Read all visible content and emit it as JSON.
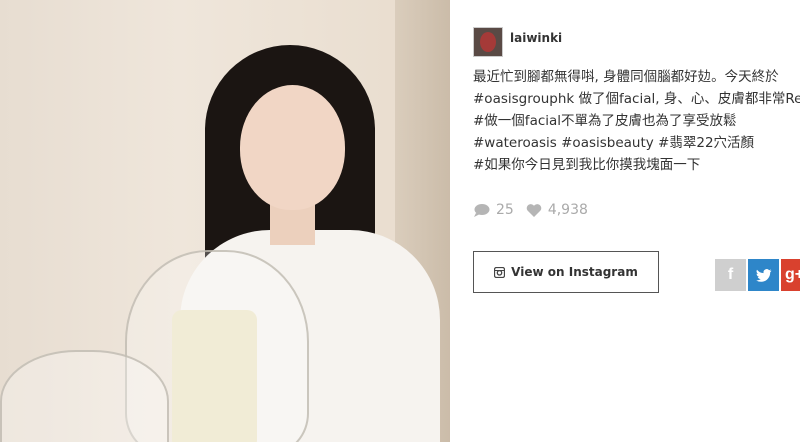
{
  "post": {
    "username": "laiwinki",
    "caption_lines": [
      "最近忙到腳都無得唞, 身體同個腦都好攰。今天終於",
      "#oasisgrouphk 做了個facial, 身、心、皮膚都非常Re",
      "#做一個facial不單為了皮膚也為了享受放鬆",
      "#wateroasis #oasisbeauty #翡翠22穴活顏",
      "#如果你今日見到我比你摸我塊面一下"
    ],
    "comments": "25",
    "likes": "4,938"
  },
  "actions": {
    "view_on_instagram": "View on Instagram",
    "share_buttons": [
      {
        "name": "facebook",
        "glyph": "f",
        "color": "#c7c7c7"
      },
      {
        "name": "twitter",
        "glyph": "t",
        "color": "#2e86c9"
      },
      {
        "name": "google-plus",
        "glyph": "g+",
        "color": "#d9412e"
      }
    ]
  }
}
